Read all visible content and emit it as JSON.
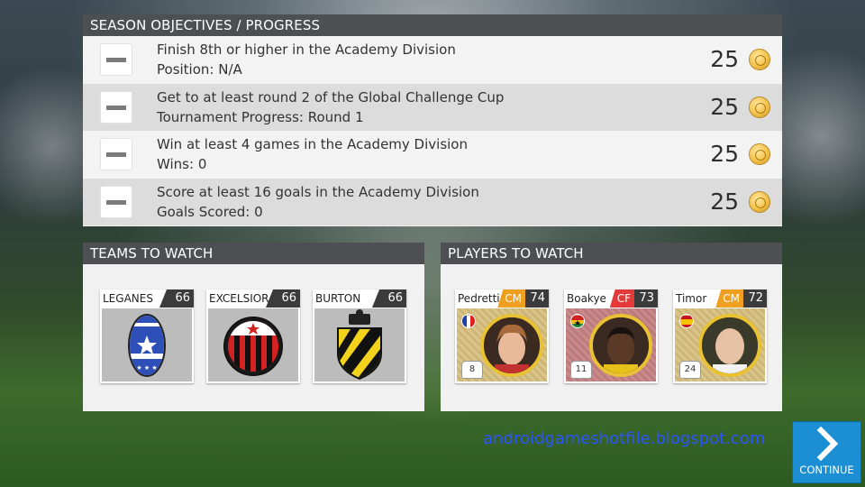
{
  "objectives": {
    "title": "SEASON OBJECTIVES / PROGRESS",
    "items": [
      {
        "title": "Finish 8th or higher in the Academy Division",
        "progress": "Position: N/A",
        "reward": "25"
      },
      {
        "title": "Get to at least round 2 of the Global Challenge Cup",
        "progress": "Tournament Progress: Round 1",
        "reward": "25"
      },
      {
        "title": "Win at least 4 games in the Academy Division",
        "progress": "Wins: 0",
        "reward": "25"
      },
      {
        "title": "Score at least 16 goals in the Academy Division",
        "progress": "Goals Scored: 0",
        "reward": "25"
      }
    ]
  },
  "teams": {
    "title": "TEAMS TO WATCH",
    "items": [
      {
        "name": "LEGANES",
        "rating": "66"
      },
      {
        "name": "EXCELSIOR",
        "rating": "66"
      },
      {
        "name": "BURTON",
        "rating": "66"
      }
    ]
  },
  "players": {
    "title": "PLAYERS TO WATCH",
    "items": [
      {
        "name": "Pedretti",
        "position": "CM",
        "rating": "74",
        "number": "8",
        "position_color": "#f0a020",
        "card_color": "#d9c48a"
      },
      {
        "name": "Boakye",
        "position": "CF",
        "rating": "73",
        "number": "11",
        "position_color": "#e53a3a",
        "card_color": "#c98a8c"
      },
      {
        "name": "Timor",
        "position": "CM",
        "rating": "72",
        "number": "24",
        "position_color": "#f0a020",
        "card_color": "#d9c48a"
      }
    ]
  },
  "watermark": "androidgameshotfile.blogspot.com",
  "continue_label": "CONTINUE",
  "colors": {
    "accent": "#1c8fd4",
    "header": "#4d4f52",
    "coin": "#f2c24a"
  }
}
